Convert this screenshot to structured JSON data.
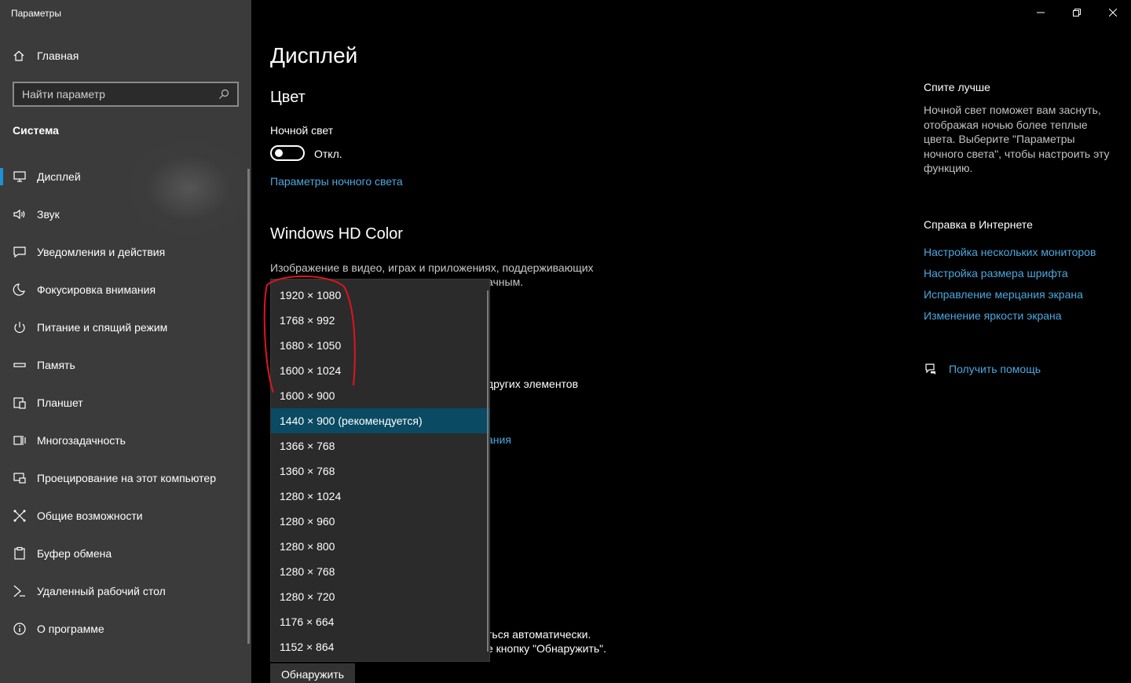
{
  "window": {
    "title": "Параметры"
  },
  "sidebar": {
    "home_label": "Главная",
    "search_placeholder": "Найти параметр",
    "section_title": "Система",
    "items": [
      {
        "label": "Дисплей",
        "icon": "monitor-icon",
        "active": true
      },
      {
        "label": "Звук",
        "icon": "speaker-icon"
      },
      {
        "label": "Уведомления и действия",
        "icon": "notification-icon"
      },
      {
        "label": "Фокусировка внимания",
        "icon": "moon-icon"
      },
      {
        "label": "Питание и спящий режим",
        "icon": "power-icon"
      },
      {
        "label": "Память",
        "icon": "storage-icon"
      },
      {
        "label": "Планшет",
        "icon": "tablet-icon"
      },
      {
        "label": "Многозадачность",
        "icon": "multitasking-icon"
      },
      {
        "label": "Проецирование на этот компьютер",
        "icon": "projecting-icon"
      },
      {
        "label": "Общие возможности",
        "icon": "shared-experiences-icon"
      },
      {
        "label": "Буфер обмена",
        "icon": "clipboard-icon"
      },
      {
        "label": "Удаленный рабочий стол",
        "icon": "remote-desktop-icon"
      },
      {
        "label": "О программе",
        "icon": "info-icon"
      }
    ]
  },
  "main": {
    "title": "Дисплей",
    "color_heading": "Цвет",
    "night_light_label": "Ночной свет",
    "night_light_state": "Откл.",
    "night_light_settings_link": "Параметры ночного света",
    "hd_color_heading": "Windows HD Color",
    "hd_color_text_1": "Изображение в видео, играх и приложениях, поддерживающих",
    "hd_color_text_2": "ачным.",
    "partial_other_elements": "других элементов",
    "partial_link": "ания",
    "detect_text_1": "ться автоматически.",
    "detect_text_2": "е кнопку \"Обнаружить\".",
    "detect_button": "Обнаружить"
  },
  "right": {
    "sleep_heading": "Спите лучше",
    "sleep_text": "Ночной свет поможет вам заснуть, отображая ночью более теплые цвета. Выберите \"Параметры ночного света\", чтобы настроить эту функцию.",
    "help_heading": "Справка в Интернете",
    "help_links": [
      "Настройка нескольких мониторов",
      "Настройка размера шрифта",
      "Исправление мерцания экрана",
      "Изменение яркости экрана"
    ],
    "get_help": "Получить помощь"
  },
  "resolution_dropdown": {
    "options": [
      "1920 × 1080",
      "1768 × 992",
      "1680 × 1050",
      "1600 × 1024",
      "1600 × 900",
      "1440 × 900 (рекомендуется)",
      "1366 × 768",
      "1360 × 768",
      "1280 × 1024",
      "1280 × 960",
      "1280 × 800",
      "1280 × 768",
      "1280 × 720",
      "1176 × 664",
      "1152 × 864"
    ],
    "selected": "1440 × 900 (рекомендуется)"
  },
  "colors": {
    "accent": "#1e90d6",
    "link": "#4ca8e0",
    "selected_bg": "#0a4a63",
    "annotation": "#e0141e"
  }
}
